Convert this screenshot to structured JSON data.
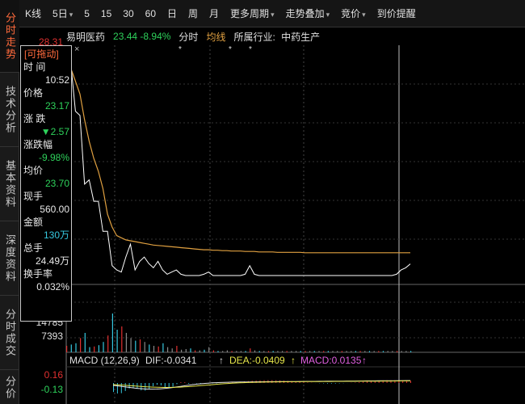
{
  "sidebar": {
    "items": [
      {
        "label": "分时走势",
        "active": true
      },
      {
        "label": "技术分析",
        "active": false
      },
      {
        "label": "基本资料",
        "active": false
      },
      {
        "label": "深度资料",
        "active": false
      },
      {
        "label": "分时成交",
        "active": false
      },
      {
        "label": "分价",
        "active": false
      }
    ]
  },
  "toolbar": {
    "items": [
      {
        "label": "K线",
        "dropdown": false
      },
      {
        "label": "5日",
        "dropdown": true
      },
      {
        "label": "5",
        "dropdown": false
      },
      {
        "label": "15",
        "dropdown": false
      },
      {
        "label": "30",
        "dropdown": false
      },
      {
        "label": "60",
        "dropdown": false
      },
      {
        "label": "日",
        "dropdown": false
      },
      {
        "label": "周",
        "dropdown": false
      },
      {
        "label": "月",
        "dropdown": false
      },
      {
        "label": "更多周期",
        "dropdown": true
      },
      {
        "label": "走势叠加",
        "dropdown": true
      },
      {
        "label": "竞价",
        "dropdown": true
      },
      {
        "label": "到价提醒",
        "dropdown": false
      }
    ]
  },
  "stock": {
    "name": "易明医药",
    "price": "23.44",
    "change_pct": "-8.94%",
    "tab_fenshi": "分时",
    "tab_junxian": "均线",
    "industry_label": "所属行业:",
    "industry": "中药生产"
  },
  "data_window": {
    "title": "[可拖动]",
    "rows": [
      {
        "label": "时  间",
        "value": "10:52",
        "color": "white"
      },
      {
        "label": "价格",
        "value": "23.17",
        "color": "green"
      },
      {
        "label": "涨  跌",
        "value": "▼2.57",
        "color": "green"
      },
      {
        "label": "涨跌幅",
        "value": "-9.98%",
        "color": "green"
      },
      {
        "label": "均价",
        "value": "23.70",
        "color": "green"
      },
      {
        "label": "现手",
        "value": "560.00",
        "color": "white"
      },
      {
        "label": "金额",
        "value": "130万",
        "color": "cyan"
      },
      {
        "label": "总手",
        "value": "24.49万",
        "color": "white"
      },
      {
        "label": "换手率",
        "value": "0.032%",
        "color": "white"
      }
    ]
  },
  "axis": {
    "price_top_partial": "28.31",
    "volume_label": "7393",
    "volume_label_partial": "14785",
    "macd_upper": "0.16",
    "macd_lower": "-0.13"
  },
  "macd": {
    "title": "MACD (12,26,9)",
    "dif": "DIF:-0.0341",
    "dea": "DEA:-0.0409",
    "macd": "MACD:0.0135",
    "arrow_up": "↑"
  },
  "colors": {
    "accent_orange": "#ff6a3c",
    "price_line": "#ffffff",
    "avg_line": "#e0a040",
    "down_green": "#2ed25b",
    "up_red": "#e03030",
    "volume_cyan": "#36c8e0",
    "dea_yellow": "#e6e64a",
    "macd_magenta": "#e060e0"
  },
  "chart_data": {
    "type": "line",
    "price_series": [
      28.3,
      28.1,
      27.0,
      26.9,
      25.3,
      25.4,
      24.9,
      24.9,
      24.2,
      24.2,
      23.4,
      23.3,
      23.25,
      23.6,
      23.9,
      23.3,
      23.5,
      23.6,
      23.45,
      23.35,
      23.5,
      23.3,
      23.2,
      23.25,
      23.3,
      23.2,
      23.17,
      23.17,
      23.17,
      23.17,
      23.2,
      23.25,
      23.17,
      23.17,
      23.17,
      23.17,
      23.17,
      23.17,
      23.17,
      23.2,
      23.4,
      23.2,
      23.17,
      23.17,
      23.17,
      23.17,
      23.17,
      23.17,
      23.17,
      23.17,
      23.17,
      23.17,
      23.17,
      23.17,
      23.17,
      23.17,
      23.17,
      23.17,
      23.17,
      23.17,
      23.17,
      23.17,
      23.17,
      23.17,
      23.17,
      23.17,
      23.17,
      23.17,
      23.17,
      23.17,
      23.17,
      23.17,
      23.2,
      23.3,
      23.35,
      23.44
    ],
    "avg_series": [
      28.3,
      28.0,
      27.7,
      27.4,
      26.8,
      26.3,
      25.9,
      25.6,
      25.2,
      24.6,
      24.3,
      24.1,
      24.05,
      24.0,
      23.98,
      23.96,
      23.94,
      23.92,
      23.9,
      23.88,
      23.87,
      23.86,
      23.85,
      23.84,
      23.83,
      23.82,
      23.81,
      23.8,
      23.79,
      23.78,
      23.77,
      23.77,
      23.76,
      23.76,
      23.75,
      23.75,
      23.74,
      23.74,
      23.74,
      23.73,
      23.73,
      23.73,
      23.72,
      23.72,
      23.72,
      23.72,
      23.71,
      23.71,
      23.71,
      23.71,
      23.71,
      23.71,
      23.7,
      23.7,
      23.7,
      23.7,
      23.7,
      23.7,
      23.7,
      23.7,
      23.7,
      23.7,
      23.7,
      23.7,
      23.7,
      23.7,
      23.7,
      23.7,
      23.7,
      23.7,
      23.7,
      23.7,
      23.7,
      23.7,
      23.7,
      23.7
    ],
    "ylim": [
      23.0,
      28.5
    ],
    "volume_series": [
      10,
      12,
      14,
      22,
      30,
      8,
      9,
      11,
      16,
      26,
      60,
      35,
      40,
      30,
      22,
      18,
      20,
      16,
      12,
      10,
      9,
      14,
      8,
      6,
      10,
      4,
      5,
      6,
      3,
      3,
      4,
      8,
      3,
      2,
      2,
      3,
      2,
      2,
      2,
      2,
      6,
      3,
      2,
      2,
      2,
      2,
      2,
      2,
      2,
      2,
      2,
      2,
      2,
      2,
      2,
      2,
      2,
      2,
      2,
      2,
      2,
      2,
      2,
      2,
      2,
      2,
      2,
      2,
      2,
      2,
      2,
      2,
      2,
      2,
      2,
      2
    ],
    "volume_ylim": [
      0,
      14785
    ],
    "macd_ylim": [
      -0.13,
      0.16
    ]
  }
}
